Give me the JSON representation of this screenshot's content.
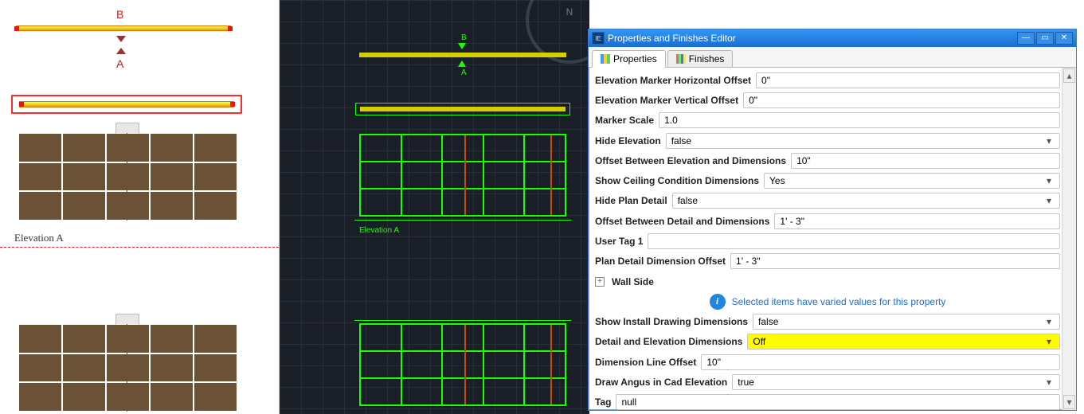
{
  "leftPanel": {
    "marker_b": "B",
    "marker_a": "A",
    "elevation_label": "Elevation A"
  },
  "midPanel": {
    "marker_b": "B",
    "marker_a": "A",
    "elevation_label": "Elevation A",
    "compass_n": "N"
  },
  "dialog": {
    "title": "Properties and Finishes Editor",
    "tabs": {
      "properties": "Properties",
      "finishes": "Finishes"
    },
    "rows": {
      "emho": {
        "label": "Elevation Marker Horizontal Offset",
        "value": "0\""
      },
      "emvo": {
        "label": "Elevation Marker Vertical Offset",
        "value": "0\""
      },
      "mscl": {
        "label": "Marker Scale",
        "value": "1.0"
      },
      "hide": {
        "label": "Hide Elevation",
        "value": "false"
      },
      "obed": {
        "label": "Offset Between Elevation and Dimensions",
        "value": "10\""
      },
      "sccd": {
        "label": "Show Ceiling Condition Dimensions",
        "value": "Yes"
      },
      "hpd": {
        "label": "Hide Plan Detail",
        "value": "false"
      },
      "obdd": {
        "label": "Offset Between Detail and Dimensions",
        "value": "1' - 3\""
      },
      "ut1": {
        "label": "User Tag 1",
        "value": ""
      },
      "pddo": {
        "label": "Plan Detail Dimension Offset",
        "value": "1' - 3\""
      },
      "wall": {
        "label": "Wall Side"
      },
      "info": "Selected items have varied values for this property",
      "sidd": {
        "label": "Show Install Drawing Dimensions",
        "value": "false"
      },
      "ded": {
        "label": "Detail and Elevation Dimensions",
        "value": "Off"
      },
      "dlo": {
        "label": "Dimension Line Offset",
        "value": "10\""
      },
      "dace": {
        "label": "Draw Angus in Cad Elevation",
        "value": "true"
      },
      "tag": {
        "label": "Tag",
        "value": "null"
      }
    }
  }
}
